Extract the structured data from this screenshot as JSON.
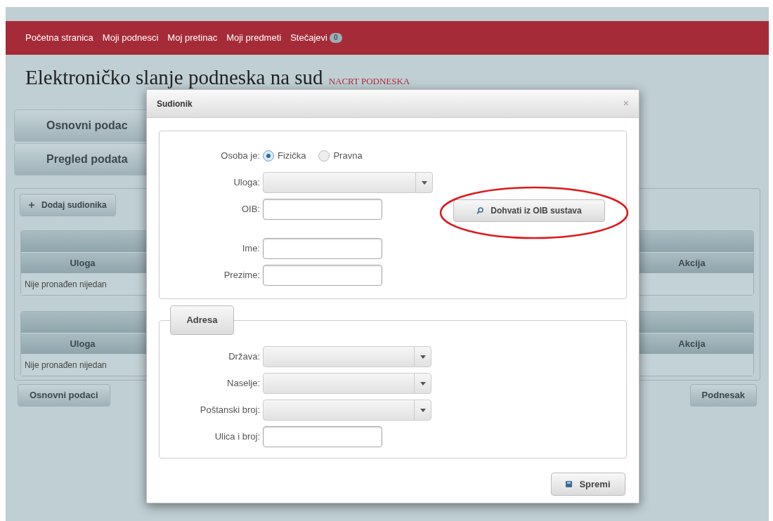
{
  "nav": {
    "items": [
      {
        "label": "Početna stranica"
      },
      {
        "label": "Moji podnesci"
      },
      {
        "label": "Moj pretinac"
      },
      {
        "label": "Moji predmeti"
      },
      {
        "label": "Stečajevi",
        "badge": "0"
      }
    ]
  },
  "page": {
    "title": "Elektroničko slanje podneska na sud",
    "status": "NACRT PODNESKA"
  },
  "accordion": [
    {
      "label": "Osnovni podac"
    },
    {
      "label": "Pregled podata"
    }
  ],
  "add_button": "Dodaj sudionika",
  "tables": [
    {
      "columns": [
        "Uloga",
        "Akcija"
      ],
      "empty_text": "Nije pronađen nijedan"
    },
    {
      "columns": [
        "Uloga",
        "Akcija"
      ],
      "empty_text": "Nije pronađen nijedan"
    }
  ],
  "footer_buttons": [
    "Osnovni podaci",
    "Podnesak"
  ],
  "dialog": {
    "title": "Sudionik",
    "close": "×",
    "person": {
      "label": "Osoba je:",
      "options": [
        {
          "label": "Fizička",
          "selected": true
        },
        {
          "label": "Pravna",
          "selected": false
        }
      ]
    },
    "fields": [
      {
        "kind": "select",
        "label": "Uloga:"
      },
      {
        "kind": "input",
        "label": "OIB:"
      },
      {
        "kind": "spacer"
      },
      {
        "kind": "input",
        "label": "Ime:"
      },
      {
        "kind": "input",
        "label": "Prezime:"
      }
    ],
    "lookup_button": "Dohvati iz OIB sustava",
    "address": {
      "legend": "Adresa",
      "fields": [
        {
          "kind": "select",
          "label": "Država:"
        },
        {
          "kind": "select",
          "label": "Naselje:"
        },
        {
          "kind": "select",
          "label": "Poštanski broj:"
        },
        {
          "kind": "input",
          "label": "Ulica i broj:"
        }
      ]
    },
    "save_button": "Spremi"
  }
}
